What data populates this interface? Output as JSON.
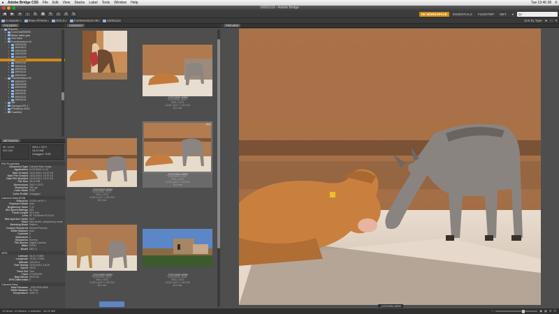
{
  "menubar": {
    "apple": "",
    "app": "Adobe Bridge CS5",
    "items": [
      "File",
      "Edit",
      "View",
      "Stacks",
      "Label",
      "Tools",
      "Window",
      "Help"
    ],
    "clock": "Tue 13:46 38"
  },
  "window": {
    "title": "10001110 - Adobe Bridge"
  },
  "toolbar": {
    "workspaces": [
      "OK WORKSPACE",
      "ESSENTIALS",
      "FILMSTRIP",
      "MET"
    ],
    "search_placeholder": "Q+"
  },
  "path": {
    "crumbs": [
      "Computer",
      "Raw-All-New",
      "DOLS",
      "Fuerteventura 08",
      "10001110"
    ],
    "sort": "Sort by Type"
  },
  "folders": {
    "tab": "FOLDERS",
    "items": [
      {
        "label": "Pictures",
        "depth": 0
      },
      {
        "label": "ConcOnt2006S0",
        "depth": 1
      },
      {
        "label": "Bilder stitch-pan",
        "depth": 1
      },
      {
        "label": "Sort New",
        "depth": 1
      },
      {
        "label": "Fuerteventura 04",
        "depth": 1
      },
      {
        "label": "10001106",
        "depth": 2
      },
      {
        "label": "10001107",
        "depth": 2
      },
      {
        "label": "10001108",
        "depth": 2
      },
      {
        "label": "10001109",
        "depth": 2
      },
      {
        "label": "10001109",
        "depth": 2
      },
      {
        "label": "10001110",
        "depth": 2,
        "selected": true
      },
      {
        "label": "10001110",
        "depth": 2
      },
      {
        "label": "10001111",
        "depth": 2
      },
      {
        "label": "10001112",
        "depth": 2
      },
      {
        "label": "10001112",
        "depth": 2
      },
      {
        "label": "10001113",
        "depth": 2
      },
      {
        "label": "Fuerteventura 02",
        "depth": 1
      },
      {
        "label": "10001107",
        "depth": 2
      },
      {
        "label": "10001108",
        "depth": 2
      },
      {
        "label": "10001109",
        "depth": 2
      },
      {
        "label": "10001110",
        "depth": 2
      },
      {
        "label": "10001111",
        "depth": 2
      },
      {
        "label": "10001112",
        "depth": 2
      },
      {
        "label": "10001113",
        "depth": 2
      },
      {
        "label": "Stil",
        "depth": 1
      },
      {
        "label": "Olympus EP-1",
        "depth": 1
      },
      {
        "label": "Photokina 2010",
        "depth": 1
      },
      {
        "label": "Cranfield",
        "depth": 1
      }
    ]
  },
  "metadata": {
    "tab": "METADATA",
    "head": {
      "aperture": "f/5",
      "shutter": "1/125",
      "dims": "3901 x 3373",
      "size": "18.22 MB",
      "iso_label": "ISO 200",
      "tagged": "Untagged",
      "color": "RGB"
    },
    "file_section": "File Properties",
    "file_rows": [
      {
        "k": "Document Type",
        "v": "Camera Raw image"
      },
      {
        "k": "Application",
        "v": "ILCE-6000 v1.10"
      },
      {
        "k": "Date Created",
        "v": "10/11/2010, 16:37:18"
      },
      {
        "k": "Date File Created",
        "v": "10/11/2010, 16:37:18"
      },
      {
        "k": "Date File Modified",
        "v": "10/11/2010, 16:37:18"
      },
      {
        "k": "File Size",
        "v": "18.22 MB"
      },
      {
        "k": "Dimensions",
        "v": "3901 x 3373"
      },
      {
        "k": "Resolution",
        "v": "300 ppi"
      },
      {
        "k": "Color Mode",
        "v": "RGB"
      },
      {
        "k": "Color Profile",
        "v": "Untagged"
      }
    ],
    "camera_section": "Camera Data (Exif)",
    "camera_rows": [
      {
        "k": "Exposure",
        "v": "1/125 s at f/7.1"
      },
      {
        "k": "Exposure Mode",
        "v": "Auto"
      },
      {
        "k": "Brightness Value",
        "v": "7.37"
      },
      {
        "k": "ISO Speed Ratings",
        "v": "200"
      },
      {
        "k": "Focal Length",
        "v": "30.0 mm"
      },
      {
        "k": "Lens",
        "v": "EF 18-55mm F3.5-5.6"
      },
      {
        "k": "Max Aperture Value",
        "v": "f/4.5"
      },
      {
        "k": "Flash",
        "v": "Did not fire, compulsory mode"
      },
      {
        "k": "Metering Mode",
        "v": "Pattern"
      },
      {
        "k": "Custom Rendered",
        "v": "Normal Process"
      },
      {
        "k": "White Balance",
        "v": "Auto"
      },
      {
        "k": "Contrast",
        "v": "0"
      },
      {
        "k": "Saturation",
        "v": "0"
      },
      {
        "k": "Sharpness",
        "v": "Normal"
      },
      {
        "k": "File Source",
        "v": "Digital Camera"
      },
      {
        "k": "Make",
        "v": "SONY"
      },
      {
        "k": "Model",
        "v": "NEX-5"
      }
    ],
    "gps_section": "GPS",
    "gps_rows": [
      {
        "k": "Latitude",
        "v": "28,21.7138N"
      },
      {
        "k": "Longitude",
        "v": "13,55.7726W"
      },
      {
        "k": "Altitude",
        "v": "109.90 m"
      },
      {
        "k": "Time Stamp",
        "v": "10/11/2010, 16:35"
      },
      {
        "k": "Speed",
        "v": "15/10"
      },
      {
        "k": "Track Ref",
        "v": "True"
      },
      {
        "k": "Track",
        "v": "27/100/100"
      },
      {
        "k": "Map Datum",
        "v": "WGS-84"
      },
      {
        "k": "GPS Differential",
        "v": "0"
      }
    ],
    "raw_section": "Camera Raw",
    "raw_rows": [
      {
        "k": "Raw Filename",
        "v": "_DSC0934.ARW"
      },
      {
        "k": "White Balance",
        "v": "As Shot"
      },
      {
        "k": "Temperature",
        "v": "4400 °K"
      }
    ]
  },
  "content": {
    "tab": "CONTENT",
    "thumbs": [
      {
        "name": "",
        "l1": "",
        "l2": "",
        "l3": "",
        "l4": ""
      },
      {
        "name": "_DSC0932.ARW",
        "l1": "10/11/2010, 16:37",
        "l2": "3901 x 3373",
        "l3": "1/125 s at f/7.1, ISO 200",
        "l4": "30.0 mm"
      },
      {
        "name": "_DSC0933.ARW",
        "l1": "10/11/2010, 16:37",
        "l2": "3901 x 3373",
        "l3": "1/125 s at f/7.1, ISO 200",
        "l4": "30.0 mm"
      },
      {
        "name": "_DSC0934.ARW",
        "l1": "10/11/2010, 16:37",
        "l2": "3901 x 3373",
        "l3": "1/125 s at f/7.1, ISO 200",
        "l4": "30.0 mm"
      },
      {
        "name": "_DSC0935.ARW",
        "l1": "10/11/2010, 16:37",
        "l2": "3901 x 3373",
        "l3": "1/125 s at f/7.1, ISO 200",
        "l4": "30.0 mm"
      },
      {
        "name": "_DSC0936.ARW",
        "l1": "10/11/2010, 16:38",
        "l2": "3901 x 3373",
        "l3": "1/125 s at f/7.1, ISO 200",
        "l4": "30.0 mm"
      }
    ],
    "stars": "• • • • •"
  },
  "preview": {
    "tab": "PREVIEW",
    "filename": "_DSC0934.ARW"
  },
  "status": {
    "text": "10 items, 10 hidden, 1 selected - 16.22 MB"
  },
  "colors": {
    "accent": "#d38a14",
    "panel": "#4b4b4b"
  }
}
